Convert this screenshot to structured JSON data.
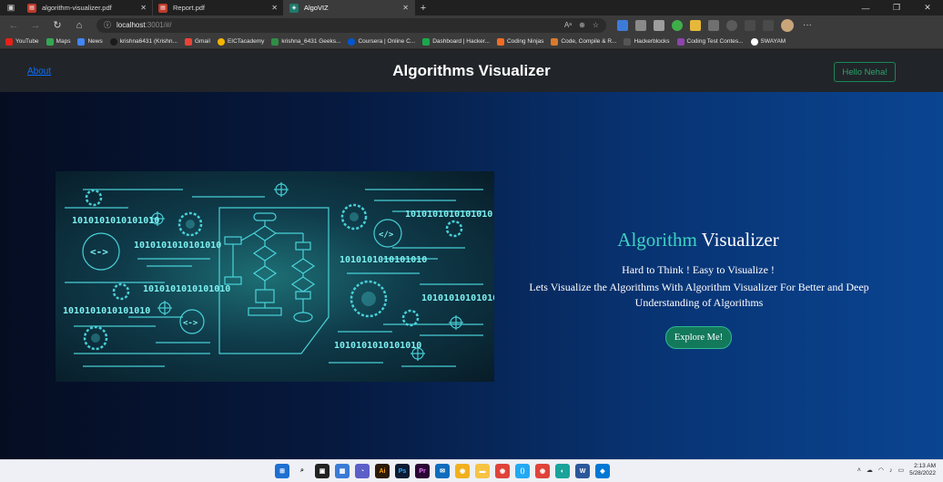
{
  "browser": {
    "tabs": [
      {
        "title": "algorithm-visualizer.pdf",
        "type": "pdf",
        "active": false
      },
      {
        "title": "Report.pdf",
        "type": "pdf",
        "active": false
      },
      {
        "title": "AlgoVIZ",
        "type": "app",
        "active": true
      }
    ],
    "address": {
      "host": "localhost",
      "rest": ":3001/#/"
    },
    "bookmarks": [
      {
        "label": "YouTube",
        "color": "#e62117"
      },
      {
        "label": "Maps",
        "color": "#34a853"
      },
      {
        "label": "News",
        "color": "#4285f4"
      },
      {
        "label": "krishna6431 (Krishn...",
        "color": "#444444"
      },
      {
        "label": "Gmail",
        "color": "#ea4335"
      },
      {
        "label": "EICTacademy",
        "color": "#f4b400"
      },
      {
        "label": "krishna_6431 Geeks...",
        "color": "#2f8d46"
      },
      {
        "label": "Coursera | Online C...",
        "color": "#0056d2"
      },
      {
        "label": "Dashboard | Hacker...",
        "color": "#1ba94c"
      },
      {
        "label": "Coding Ninjas",
        "color": "#f36c24"
      },
      {
        "label": "Code, Compile & R...",
        "color": "#d97a2b"
      },
      {
        "label": "Hackerblocks",
        "color": "#555555"
      },
      {
        "label": "Coding Test Contes...",
        "color": "#8e44ad"
      },
      {
        "label": "SWAYAM",
        "color": "#ffffff"
      }
    ]
  },
  "navbar": {
    "about": "About",
    "brand": "Algorithms Visualizer",
    "greeting": "Hello Neha!"
  },
  "hero": {
    "title_accent": "Algorithm",
    "title_rest": " Visualizer",
    "subtitle": "Hard to Think ! Easy to Visualize !",
    "description": "Lets Visualize the Algorithms With Algorithm Visualizer For Better and Deep Understanding of Algorithms",
    "cta": "Explore Me!",
    "art_binary": "1010101010101010",
    "art_code": "<->",
    "art_code2": "</>"
  },
  "taskbar": {
    "time": "2:13 AM",
    "date": "5/28/2022"
  },
  "colors": {
    "accent_teal": "#3fd3c2",
    "cta_green": "#13795b",
    "link_blue": "#0d6efd"
  }
}
